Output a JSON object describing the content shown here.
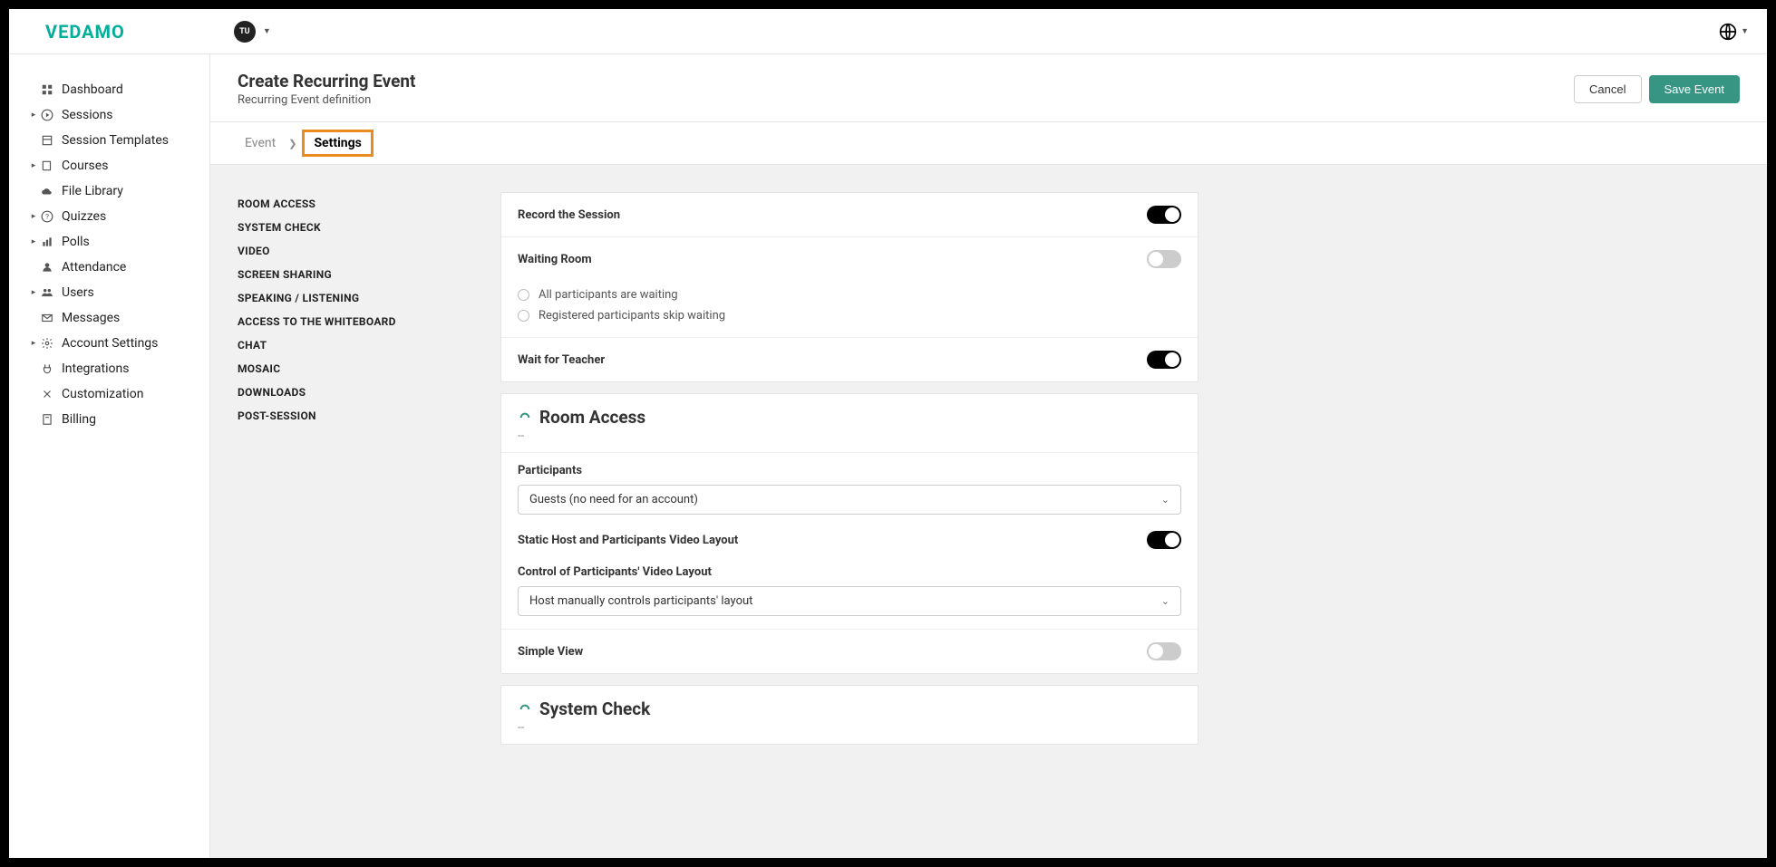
{
  "brand": "VEDAMO",
  "avatar_initials": "TU",
  "header": {
    "title": "Create Recurring Event",
    "subtitle": "Recurring Event definition",
    "cancel_label": "Cancel",
    "save_label": "Save Event"
  },
  "tabs": {
    "event": "Event",
    "settings": "Settings"
  },
  "sidebar": [
    {
      "icon": "dashboard",
      "label": "Dashboard",
      "caret": false
    },
    {
      "icon": "play",
      "label": "Sessions",
      "caret": true
    },
    {
      "icon": "template",
      "label": "Session Templates",
      "caret": false
    },
    {
      "icon": "book",
      "label": "Courses",
      "caret": true
    },
    {
      "icon": "cloud",
      "label": "File Library",
      "caret": false
    },
    {
      "icon": "help",
      "label": "Quizzes",
      "caret": true
    },
    {
      "icon": "chart",
      "label": "Polls",
      "caret": true
    },
    {
      "icon": "person",
      "label": "Attendance",
      "caret": false
    },
    {
      "icon": "people",
      "label": "Users",
      "caret": true
    },
    {
      "icon": "mail",
      "label": "Messages",
      "caret": false
    },
    {
      "icon": "gear",
      "label": "Account Settings",
      "caret": true
    },
    {
      "icon": "plug",
      "label": "Integrations",
      "caret": false
    },
    {
      "icon": "tools",
      "label": "Customization",
      "caret": false
    },
    {
      "icon": "billing",
      "label": "Billing",
      "caret": false
    }
  ],
  "sub_nav": [
    "ROOM ACCESS",
    "SYSTEM CHECK",
    "VIDEO",
    "SCREEN SHARING",
    "SPEAKING / LISTENING",
    "ACCESS TO THE WHITEBOARD",
    "CHAT",
    "MOSAIC",
    "DOWNLOADS",
    "POST-SESSION"
  ],
  "settings": {
    "record_session": {
      "label": "Record the Session",
      "on": true
    },
    "waiting_room": {
      "label": "Waiting Room",
      "on": false,
      "options": [
        "All participants are waiting",
        "Registered participants skip waiting"
      ]
    },
    "wait_teacher": {
      "label": "Wait for Teacher",
      "on": true
    },
    "room_access": {
      "title": "Room Access",
      "sub": "--",
      "participants_label": "Participants",
      "participants_value": "Guests (no need for an account)",
      "static_layout": {
        "label": "Static Host and Participants Video Layout",
        "on": true
      },
      "control_label": "Control of Participants' Video Layout",
      "control_value": "Host manually controls participants' layout",
      "simple_view": {
        "label": "Simple View",
        "on": false
      }
    },
    "system_check": {
      "title": "System Check",
      "sub": "--"
    }
  }
}
